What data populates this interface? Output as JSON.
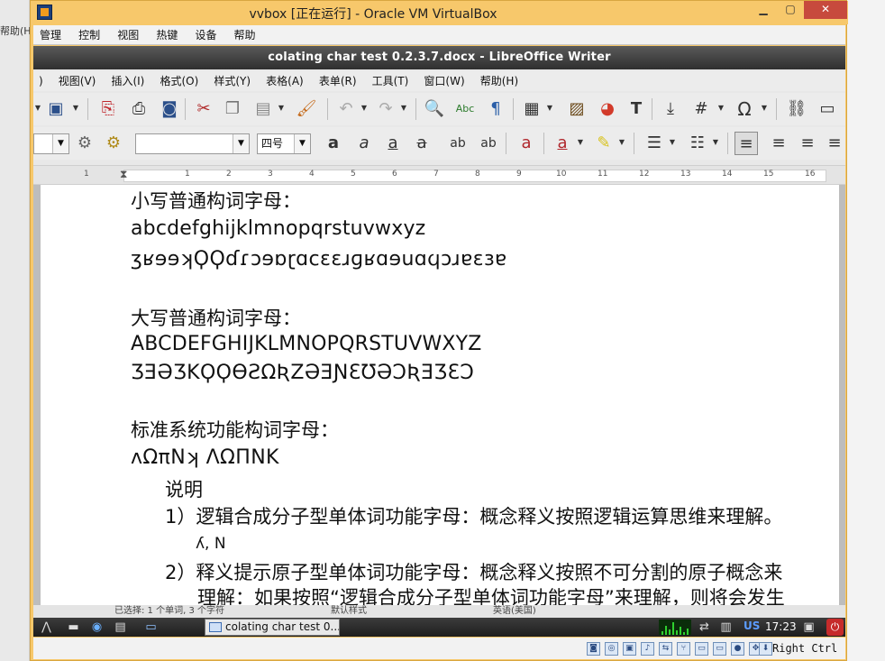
{
  "host": {
    "left_label": "帮助(H",
    "right_hint": ""
  },
  "vbox": {
    "title": "vvbox [正在运行] - Oracle VM VirtualBox",
    "menu": [
      "管理",
      "控制",
      "视图",
      "热键",
      "设备",
      "帮助"
    ],
    "host_key": "Right Ctrl"
  },
  "writer": {
    "title": "colating char test 0.2.3.7.docx - LibreOffice Writer",
    "menu": [
      ")",
      "视图(V)",
      "插入(I)",
      "格式(O)",
      "样式(Y)",
      "表格(A)",
      "表单(R)",
      "工具(T)",
      "窗口(W)",
      "帮助(H)"
    ],
    "font_size": "四号",
    "font_name": "",
    "ruler_numbers": [
      "1",
      "1",
      "2",
      "3",
      "4",
      "5",
      "6",
      "7",
      "8",
      "9",
      "10",
      "11",
      "12",
      "13",
      "14",
      "15",
      "16"
    ],
    "status": {
      "words": "已选择: 1 个单词, 3 个字符",
      "style": "默认样式",
      "lang": "英语(美国)"
    }
  },
  "document": {
    "lines": [
      "小写普通构词字母：",
      "abcdefghijklmnopqrstuvwxyz",
      "ʒʁɘɘʞϘϘɗɾɔɘɒɽɑϲɛɛɹɡʁɑɘuɑϥɔɹɐɛɜɐ",
      "大写普通构词字母：",
      "ABCDEFGHIJKLMNOPQRSTUVWXYZ",
      "ƷƎƏƷKϘϘƟƧΩƦΖƏƎƝƐƱƏƆƦƎƷƐƆ",
      "标准系统功能构词字母：",
      "ʌΩπNʞ  ɅΩΠNK",
      "说明",
      "1）逻辑合成分子型单体词功能字母：概念释义按照逻辑运算思维来理解。",
      "ʎ, N",
      "2）释义提示原子型单体词功能字母：概念释义按照不可分割的原子概念来",
      "理解：如果按照“逻辑合成分子型单体词功能字母”来理解，则将会发生"
    ]
  },
  "taskbar": {
    "task_label": "colating char test 0....",
    "keyboard": "US",
    "clock": "17:23"
  }
}
